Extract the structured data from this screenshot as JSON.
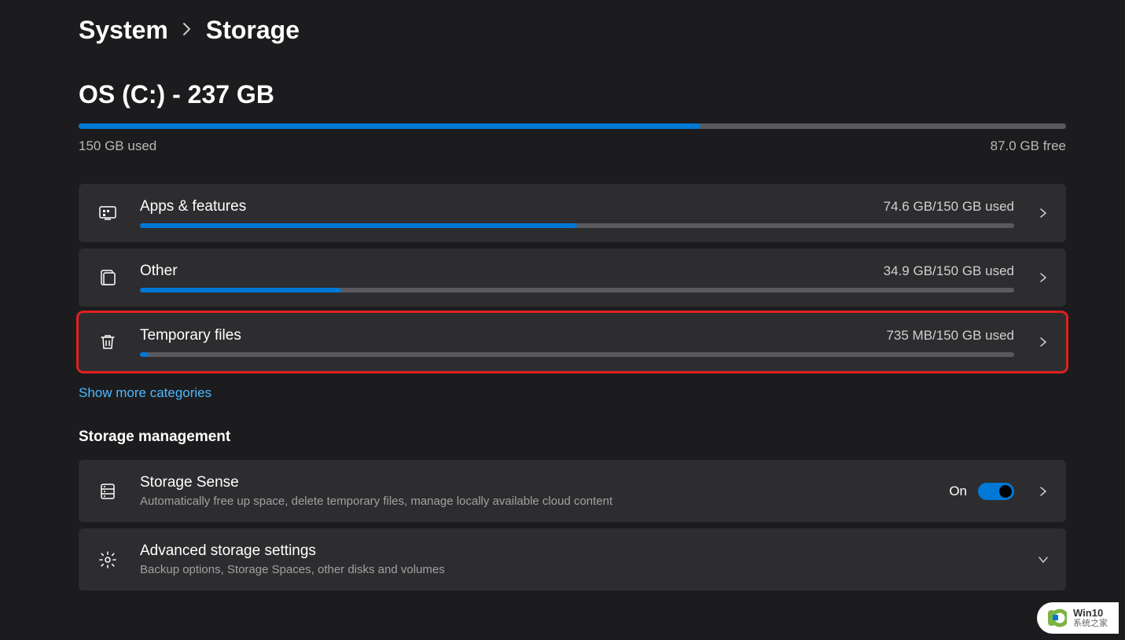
{
  "breadcrumb": {
    "parent": "System",
    "current": "Storage"
  },
  "drive": {
    "title": "OS (C:) - 237 GB",
    "used_label": "150 GB used",
    "free_label": "87.0 GB free",
    "used_percent": 63
  },
  "categories": [
    {
      "icon": "apps",
      "title": "Apps & features",
      "usage": "74.6 GB/150 GB used",
      "percent": 50,
      "highlighted": false
    },
    {
      "icon": "other",
      "title": "Other",
      "usage": "34.9 GB/150 GB used",
      "percent": 23,
      "highlighted": false
    },
    {
      "icon": "trash",
      "title": "Temporary files",
      "usage": "735 MB/150 GB used",
      "percent": 1,
      "highlighted": true
    }
  ],
  "show_more": "Show more categories",
  "section_heading": "Storage management",
  "mgmt": [
    {
      "icon": "storage-sense",
      "title": "Storage Sense",
      "sub": "Automatically free up space, delete temporary files, manage locally available cloud content",
      "toggle": {
        "state_label": "On",
        "on": true
      },
      "action": "chevron-right"
    },
    {
      "icon": "gear",
      "title": "Advanced storage settings",
      "sub": "Backup options, Storage Spaces, other disks and volumes",
      "action": "chevron-down"
    }
  ],
  "watermark": {
    "line1": "Win10",
    "line2": "系统之家"
  },
  "colors": {
    "accent": "#0078d4",
    "highlight": "#e02020",
    "link": "#4db8ff"
  }
}
